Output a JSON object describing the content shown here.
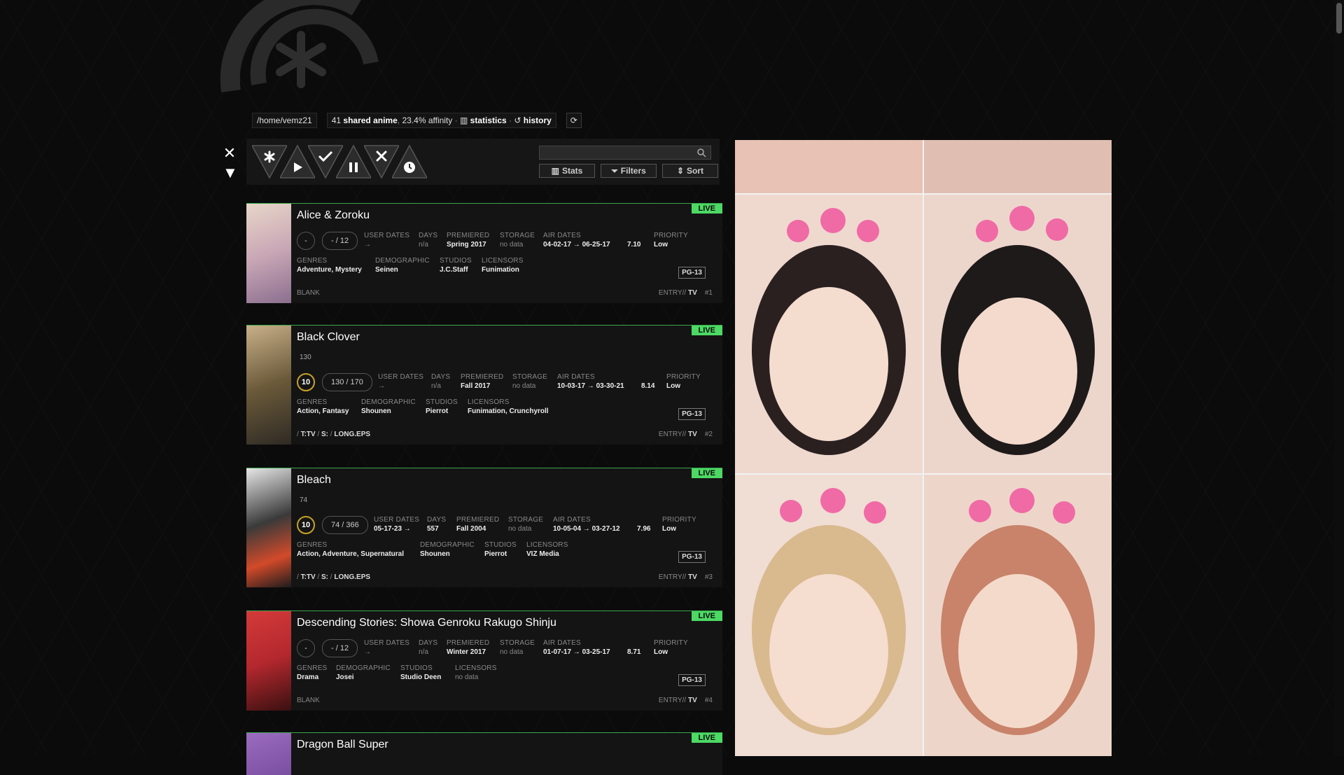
{
  "profile": {
    "path": "/home/vemz21",
    "shared_count": "41",
    "shared_label": "shared anime",
    "affinity": "23.4% affinity",
    "statistics_label": "statistics",
    "history_label": "history"
  },
  "toolbar": {
    "stats_label": "Stats",
    "filters_label": "Filters",
    "sort_label": "Sort",
    "search_placeholder": ""
  },
  "cards": [
    {
      "title": "Alice & Zoroku",
      "status": "LIVE",
      "score": "-",
      "episodes": "- / 12",
      "user_dates": "→",
      "days": "n/a",
      "premiered": "Spring 2017",
      "storage": "no data",
      "air_dates": "04-02-17 → 06-25-17",
      "mean": "7.10",
      "priority": "Low",
      "genres": "Adventure, Mystery",
      "demographic": "Seinen",
      "studios": "J.C.Staff",
      "licensors": "Funimation",
      "rating": "PG-13",
      "footer_left": "BLANK",
      "entry": "ENTRY//",
      "type": "TV",
      "index": "#1",
      "cover_color": "#c9a7b6"
    },
    {
      "title": "Black Clover",
      "status": "LIVE",
      "progress": "130",
      "score": "10",
      "episodes": "130 / 170",
      "user_dates": "→",
      "days": "n/a",
      "premiered": "Fall 2017",
      "storage": "no data",
      "air_dates": "10-03-17 → 03-30-21",
      "mean": "8.14",
      "priority": "Low",
      "genres": "Action, Fantasy",
      "demographic": "Shounen",
      "studios": "Pierrot",
      "licensors": "Funimation, Crunchyroll",
      "rating": "PG-13",
      "tag_type": "T:TV",
      "tag_s": "S:",
      "tag_eps": "LONG.EPS",
      "entry": "ENTRY//",
      "type": "TV",
      "index": "#2",
      "cover_color": "#6b5a3a"
    },
    {
      "title": "Bleach",
      "status": "LIVE",
      "progress": "74",
      "score": "10",
      "episodes": "74 / 366",
      "user_dates": "05-17-23 →",
      "days": "557",
      "premiered": "Fall 2004",
      "storage": "no data",
      "air_dates": "10-05-04 → 03-27-12",
      "mean": "7.96",
      "priority": "Low",
      "genres": "Action, Adventure, Supernatural",
      "demographic": "Shounen",
      "studios": "Pierrot",
      "licensors": "VIZ Media",
      "rating": "PG-13",
      "tag_type": "T:TV",
      "tag_s": "S:",
      "tag_eps": "LONG.EPS",
      "entry": "ENTRY//",
      "type": "TV",
      "index": "#3",
      "cover_color": "#3a3a3a"
    },
    {
      "title": "Descending Stories: Showa Genroku Rakugo Shinju",
      "status": "LIVE",
      "score": "-",
      "episodes": "- / 12",
      "user_dates": "→",
      "days": "n/a",
      "premiered": "Winter 2017",
      "storage": "no data",
      "air_dates": "01-07-17 → 03-25-17",
      "mean": "8.71",
      "priority": "Low",
      "genres": "Drama",
      "demographic": "Josei",
      "studios": "Studio Deen",
      "licensors": "no data",
      "rating": "PG-13",
      "footer_left": "BLANK",
      "entry": "ENTRY//",
      "type": "TV",
      "index": "#4",
      "cover_color": "#b3282e"
    },
    {
      "title": "Dragon Ball Super",
      "status": "LIVE",
      "cover_color": "#7a4ea0"
    }
  ],
  "labels": {
    "user_dates": "USER DATES",
    "days": "DAYS",
    "premiered": "PREMIERED",
    "storage": "STORAGE",
    "air_dates": "AIR DATES",
    "priority": "PRIORITY",
    "genres": "GENRES",
    "demographic": "DEMOGRAPHIC",
    "studios": "STUDIOS",
    "licensors": "LICENSORS"
  },
  "colors": {
    "accent_live": "#4cd964",
    "score_gold": "#c9a227",
    "card_border": "#3aa64a"
  }
}
